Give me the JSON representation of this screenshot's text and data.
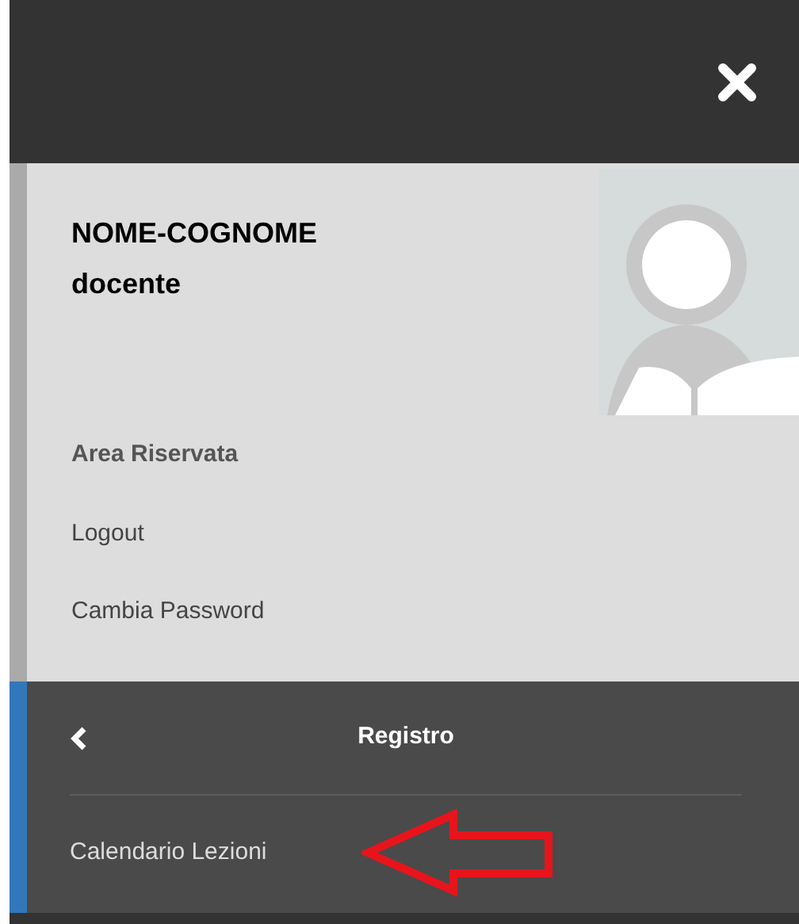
{
  "profile": {
    "name": "NOME-COGNOME",
    "role": "docente"
  },
  "account": {
    "heading": "Area Riservata",
    "links": [
      "Logout",
      "Cambia Password"
    ]
  },
  "menu": {
    "title": "Registro",
    "items": [
      {
        "label": "Calendario Lezioni",
        "highlighted": true
      }
    ]
  }
}
